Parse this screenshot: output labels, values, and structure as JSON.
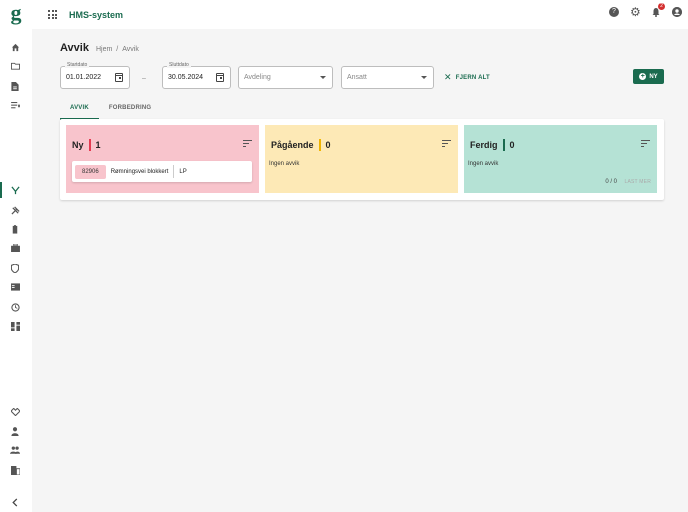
{
  "app": {
    "name": "HMS-system",
    "logo_letter": "g",
    "brand_color": "#1a6b4f"
  },
  "topbar": {
    "icons": [
      "apps-grid-icon",
      "help-icon",
      "gear-icon",
      "bell-icon",
      "account-icon"
    ],
    "notification_count": "2"
  },
  "sidebar": {
    "top_icons": [
      "home-icon",
      "folder-icon",
      "document-icon",
      "list-icon"
    ],
    "mid_icons": [
      "deviation-icon",
      "tools-icon",
      "battery-icon",
      "briefcase-icon",
      "shield-icon",
      "book-icon",
      "history-icon",
      "dashboard-icon"
    ],
    "bottom_icons": [
      "handshake-icon",
      "person-icon",
      "people-icon",
      "building-icon",
      "chevron-left-icon"
    ],
    "active": "deviation-icon"
  },
  "page": {
    "title": "Avvik",
    "breadcrumb": [
      "Hjem",
      "Avvik"
    ]
  },
  "filters": {
    "start_label": "Startdato",
    "start_value": "01.01.2022",
    "end_label": "Sluttdato",
    "end_value": "30.05.2024",
    "separator": "–",
    "department_placeholder": "Avdeling",
    "employee_placeholder": "Ansatt",
    "clear_label": "FJERN ALT",
    "new_label": "NY"
  },
  "tabs": [
    {
      "label": "AVVIK",
      "active": true
    },
    {
      "label": "FORBEDRING",
      "active": false
    }
  ],
  "columns": [
    {
      "title": "Ny",
      "count": "1",
      "color": "#f8c4cc",
      "bar_color": "#e53950",
      "cards": [
        {
          "id": "82906",
          "text": "Rømningsvei blokkert",
          "user": "LP"
        }
      ]
    },
    {
      "title": "Pågående",
      "count": "0",
      "color": "#fde9b6",
      "bar_color": "#f0b400",
      "empty_text": "Ingen avvik"
    },
    {
      "title": "Ferdig",
      "count": "0",
      "color": "#b5e2d5",
      "bar_color": "#1a6b4f",
      "empty_text": "Ingen avvik",
      "pager": "0 / 0",
      "load_more": "LAST MER"
    }
  ]
}
